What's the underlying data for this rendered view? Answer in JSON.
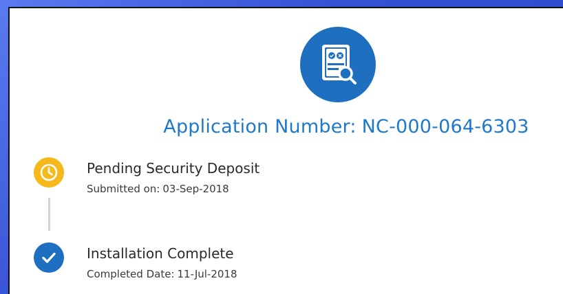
{
  "application": {
    "label": "Application Number:",
    "number": "NC-000-064-6303"
  },
  "icons": {
    "header": "application-search-icon",
    "pending": "clock-icon",
    "complete": "checkmark-icon"
  },
  "colors": {
    "brand_blue": "#1e6fbf",
    "title_blue": "#1f78c8",
    "pending_yellow": "#f5b91c",
    "background": "#3b57d8"
  },
  "steps": [
    {
      "status": "pending",
      "title": "Pending Security Deposit",
      "date_label": "Submitted on:",
      "date": "03-Sep-2018"
    },
    {
      "status": "complete",
      "title": "Installation Complete",
      "date_label": "Completed Date:",
      "date": "11-Jul-2018"
    }
  ]
}
